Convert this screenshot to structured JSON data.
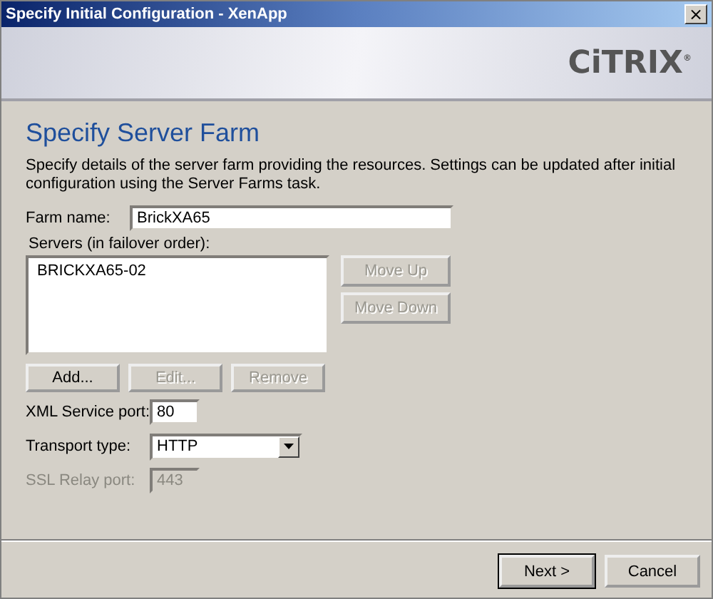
{
  "window": {
    "title": "Specify Initial Configuration - XenApp",
    "close": "×"
  },
  "header": {
    "logo": "CiTRIX",
    "logo_mark": "®"
  },
  "heading": "Specify Server Farm",
  "description": "Specify details of the server farm providing the resources. Settings can be updated after initial configuration using the Server Farms task.",
  "farm_name": {
    "label": "Farm name:",
    "value": "BrickXA65"
  },
  "servers": {
    "label": "Servers (in failover order):",
    "items": [
      {
        "text": "BRICKXA65-02",
        "selected": false
      }
    ]
  },
  "order_buttons": [
    {
      "label": "Move Up",
      "disabled": true
    },
    {
      "label": "Move Down",
      "disabled": true
    }
  ],
  "list_buttons": [
    {
      "label": "Add...",
      "disabled": false
    },
    {
      "label": "Edit...",
      "disabled": true
    },
    {
      "label": "Remove",
      "disabled": true
    }
  ],
  "fields": [
    {
      "kind": "text",
      "label": "XML Service port:",
      "value": "80",
      "disabled": false
    },
    {
      "kind": "select",
      "label": "Transport type:",
      "value": "HTTP",
      "disabled": false
    },
    {
      "kind": "text",
      "label": "SSL Relay port:",
      "value": "443",
      "disabled": true
    }
  ],
  "footer_buttons": [
    {
      "label": "Next >",
      "default": true
    },
    {
      "label": "Cancel",
      "default": false
    }
  ]
}
